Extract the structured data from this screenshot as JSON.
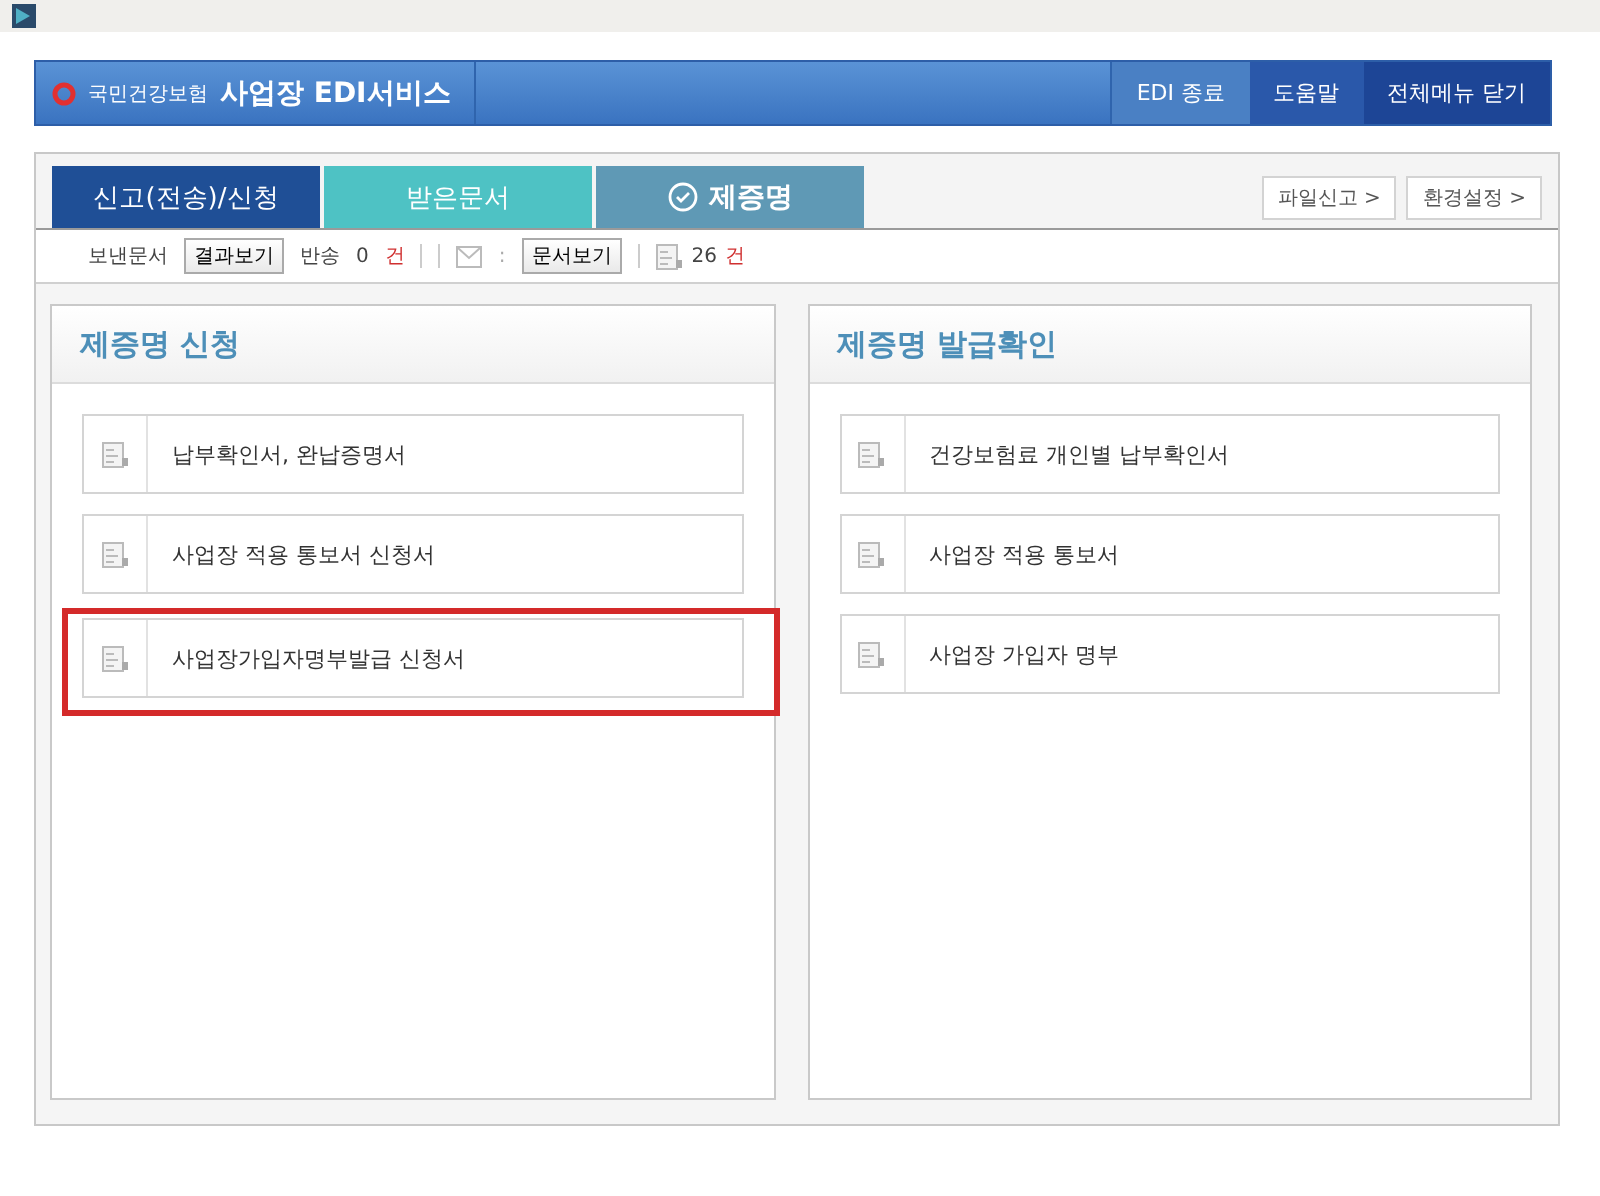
{
  "header": {
    "logo": "국민건강보험",
    "title": "사업장 EDI서비스",
    "buttons": [
      {
        "label": "EDI 종료",
        "color": "#4a80c4"
      },
      {
        "label": "도움말",
        "color": "#2a58aa"
      },
      {
        "label": "전체메뉴 닫기",
        "color": "#1d4596"
      }
    ]
  },
  "tabs": [
    {
      "label": "신고(전송)/신청",
      "selected": false,
      "color": "#1f4f96"
    },
    {
      "label": "받은문서",
      "selected": false,
      "color": "#4ec2c4"
    },
    {
      "label": "제증명",
      "selected": true,
      "color": "#5f99b5"
    }
  ],
  "links": [
    "파일신고 >",
    "환경설정 >"
  ],
  "toolbar": {
    "sent_label": "보낸문서",
    "result_button": "결과보기",
    "returned_label": "반송",
    "returned_count": "0",
    "returned_unit": "건",
    "colon": ":",
    "view_button": "문서보기",
    "doc_count": "26",
    "doc_unit": "건"
  },
  "panels": [
    {
      "title": "제증명 신청",
      "items": [
        {
          "label": "납부확인서, 완납증명서",
          "highlighted": false
        },
        {
          "label": "사업장 적용 통보서 신청서",
          "highlighted": false
        },
        {
          "label": "사업장가입자명부발급 신청서",
          "highlighted": true
        }
      ]
    },
    {
      "title": "제증명 발급확인",
      "items": [
        {
          "label": "건강보험료 개인별 납부확인서",
          "highlighted": false
        },
        {
          "label": "사업장 적용 통보서",
          "highlighted": false
        },
        {
          "label": "사업장 가입자 명부",
          "highlighted": false
        }
      ]
    }
  ]
}
